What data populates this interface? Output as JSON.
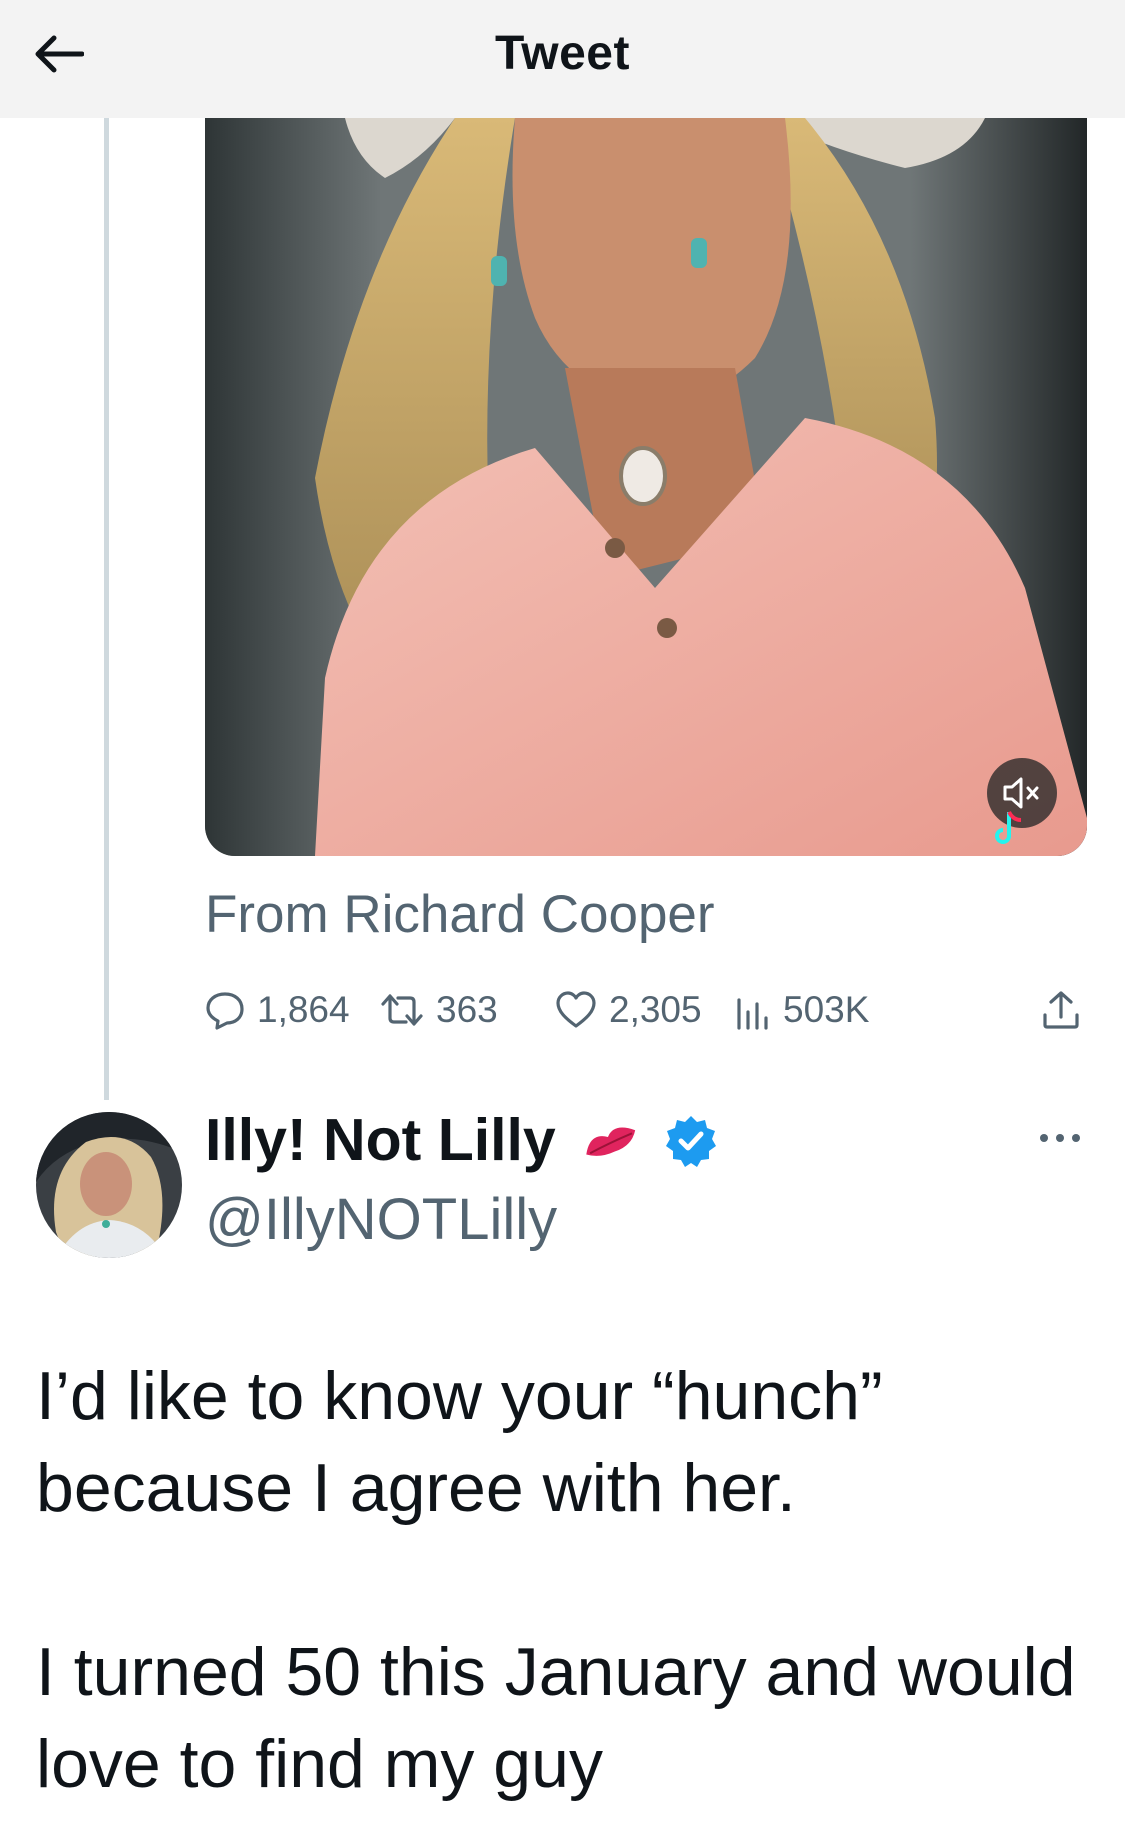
{
  "header": {
    "title": "Tweet"
  },
  "quoted_tweet": {
    "attribution": "From Richard Cooper",
    "stats": {
      "replies": "1,864",
      "retweets": "363",
      "likes": "2,305",
      "views": "503K"
    }
  },
  "tweet": {
    "display_name": "Illy! Not Lilly",
    "handle": "@IllyNOTLilly",
    "paragraphs": [
      "I’d like to know your “hunch” because I agree with her.",
      "I turned 50 this January and would love to find my guy"
    ]
  },
  "icons": [
    "back-arrow-icon",
    "mute-icon",
    "tiktok-icon",
    "reply-icon",
    "retweet-icon",
    "like-icon",
    "views-icon",
    "share-icon",
    "kiss-icon",
    "verified-icon",
    "more-icon"
  ],
  "colors": {
    "text": "#0f1419",
    "secondary": "#536471",
    "verified": "#1d9bf0",
    "kiss": "#e0245e"
  }
}
